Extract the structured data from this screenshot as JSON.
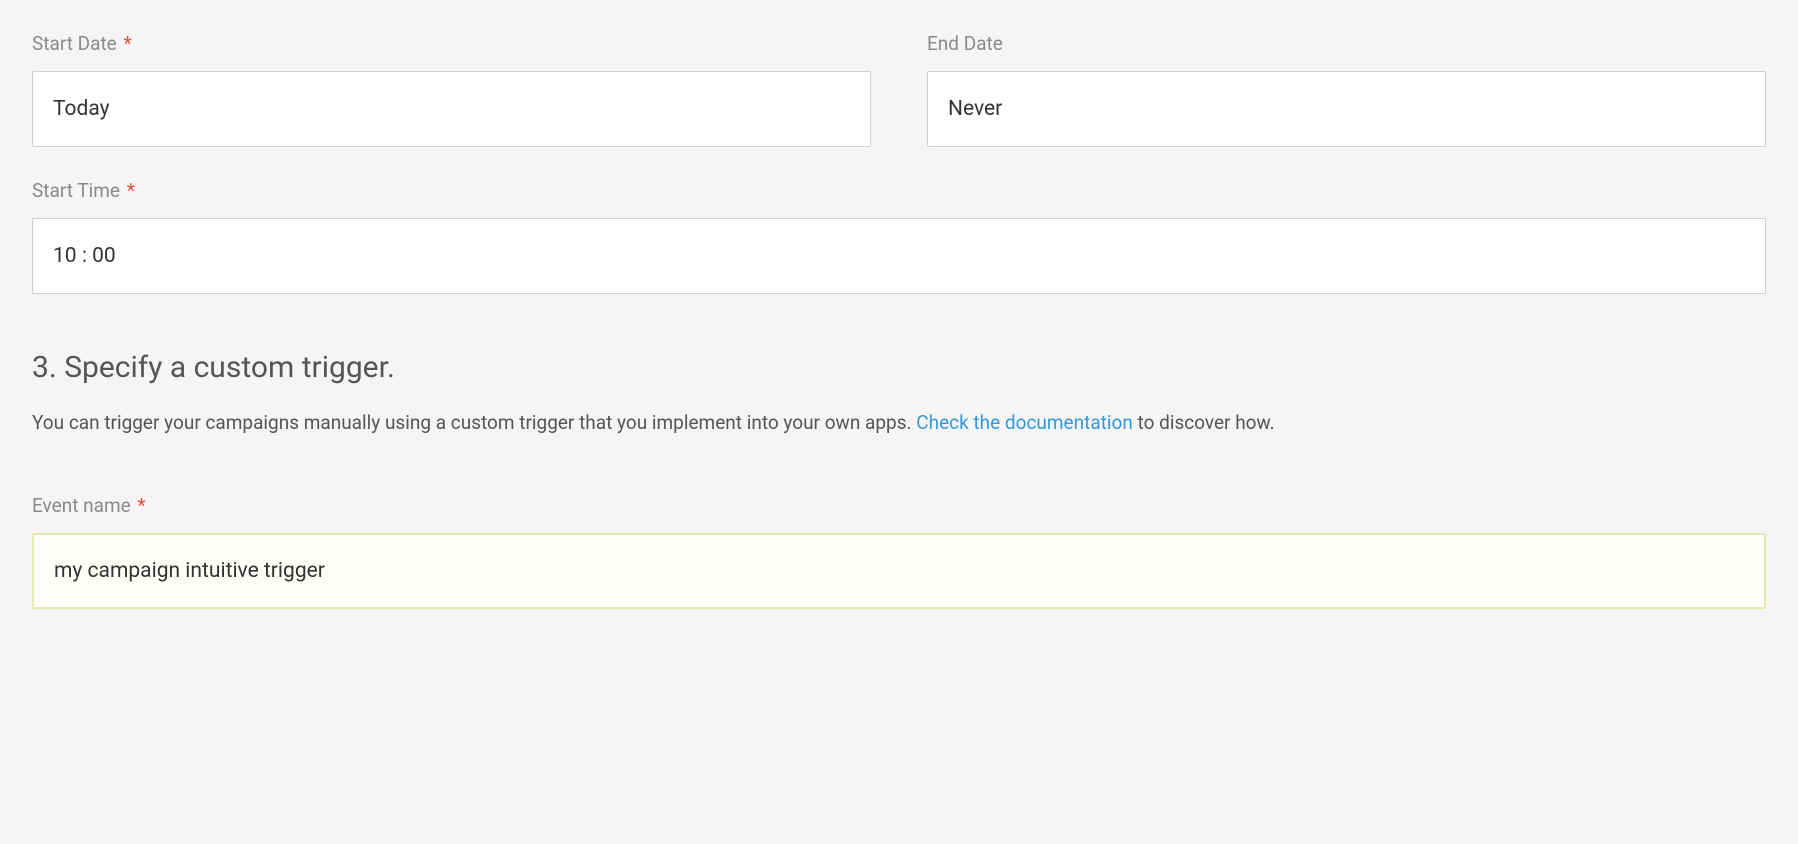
{
  "startDate": {
    "label": "Start Date",
    "required": "*",
    "value": "Today"
  },
  "endDate": {
    "label": "End Date",
    "value": "Never"
  },
  "startTime": {
    "label": "Start Time",
    "required": "*",
    "value": "10 : 00"
  },
  "section": {
    "heading": "3. Specify a custom trigger.",
    "descriptionBefore": "You can trigger your campaigns manually using a custom trigger that you implement into your own apps. ",
    "linkText": "Check the documentation",
    "descriptionAfter": " to discover how."
  },
  "eventName": {
    "label": "Event name",
    "required": "*",
    "value": "my campaign intuitive trigger"
  }
}
